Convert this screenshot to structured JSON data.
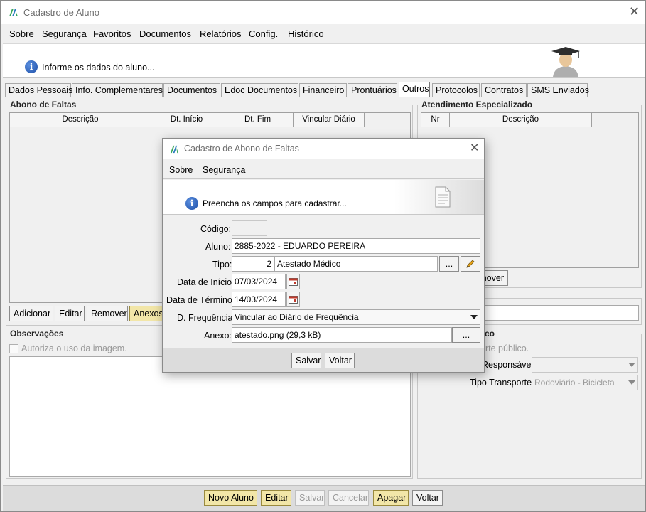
{
  "window": {
    "title": "Cadastro de Aluno"
  },
  "menu": [
    {
      "label": "Sobre"
    },
    {
      "label": "Segurança"
    },
    {
      "label": "Favoritos"
    },
    {
      "label": "Documentos"
    },
    {
      "label": "Relatórios"
    },
    {
      "label": "Config."
    },
    {
      "label": "Histórico"
    }
  ],
  "info": {
    "text": "Informe os dados do aluno..."
  },
  "tabs": [
    {
      "label": "Dados Pessoais"
    },
    {
      "label": "Info. Complementares"
    },
    {
      "label": "Documentos"
    },
    {
      "label": "Edoc Documentos"
    },
    {
      "label": "Financeiro"
    },
    {
      "label": "Prontuários"
    },
    {
      "label": "Outros",
      "active": true
    },
    {
      "label": "Protocolos"
    },
    {
      "label": "Contratos"
    },
    {
      "label": "SMS Enviados"
    }
  ],
  "abono": {
    "title": "Abono de Faltas",
    "columns": [
      "Descrição",
      "Dt. Início",
      "Dt. Fim",
      "Vincular Diário"
    ],
    "buttons": {
      "add": "Adicionar",
      "edit": "Editar",
      "remove": "Remover",
      "attach": "Anexos"
    }
  },
  "atendimento": {
    "title": "Atendimento Especializado",
    "columns": [
      "Nr",
      "Descrição"
    ],
    "remove_partial": "nover"
  },
  "observacoes": {
    "title": "Observações",
    "checkbox_label": "Autoriza o uso da imagem."
  },
  "transporte": {
    "title_partial": "co",
    "checkbox_partial": "rte público.",
    "responsavel_label": "Responsável:",
    "tipo_label": "Tipo Transporte:",
    "tipo_value": "Rodoviário - Bicicleta"
  },
  "bottom_buttons": {
    "novo": "Novo Aluno",
    "editar": "Editar",
    "salvar": "Salvar",
    "cancelar": "Cancelar",
    "apagar": "Apagar",
    "voltar": "Voltar"
  },
  "dialog": {
    "title": "Cadastro de Abono de Faltas",
    "menu": [
      {
        "label": "Sobre"
      },
      {
        "label": "Segurança"
      }
    ],
    "info": "Preencha os campos para cadastrar...",
    "labels": {
      "codigo": "Código:",
      "aluno": "Aluno:",
      "tipo": "Tipo:",
      "data_inicio": "Data de Início:",
      "data_termino": "Data de Término:",
      "frequencia": "D. Frequência:",
      "anexo": "Anexo:"
    },
    "values": {
      "codigo": "",
      "aluno": "2885-2022 - EDUARDO PEREIRA",
      "tipo_num": "2",
      "tipo_desc": "Atestado Médico",
      "data_inicio": "07/03/2024",
      "data_termino": "14/03/2024",
      "frequencia": "Vincular ao Diário de Frequência",
      "anexo": "atestado.png (29,3 kB)"
    },
    "ellipsis": "...",
    "buttons": {
      "salvar": "Salvar",
      "voltar": "Voltar"
    }
  },
  "colors": {
    "accent_yellow": "#f2e6a8",
    "info_blue": "#1d4fa8"
  }
}
